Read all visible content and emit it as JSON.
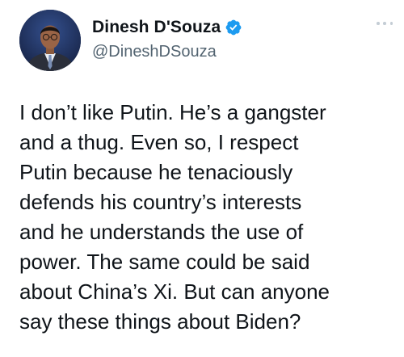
{
  "author": {
    "display_name": "Dinesh D'Souza",
    "handle": "@DineshDSouza",
    "verified": true,
    "avatar_icon": "user-avatar-photo"
  },
  "tweet": {
    "lines": [
      "I don’t like Putin. He’s a gangster",
      "and a thug. Even so, I respect",
      "Putin because he tenaciously",
      "defends his country’s interests",
      "and he understands the use of",
      "power. The same could be said",
      "about China’s Xi.  But can anyone",
      "say these things about Biden?"
    ]
  },
  "menu": {
    "icon": "more-horizontal-icon"
  },
  "colors": {
    "text_primary": "#0f1419",
    "text_secondary": "#536471",
    "verified_blue": "#1d9bf0",
    "background": "#ffffff"
  }
}
